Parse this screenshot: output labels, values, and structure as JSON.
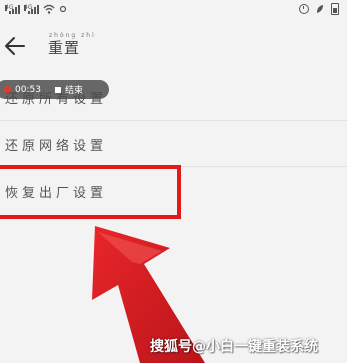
{
  "status_bar": {
    "network_label": "4G",
    "signal_icon": "signal-bars-icon",
    "wifi_icon": "wifi-icon",
    "alarm_icon": "alarm-clock-icon",
    "battery_icon": "battery-icon"
  },
  "header": {
    "back_icon": "arrow-left-icon",
    "title_pinyin": "zhòng zhì",
    "title": "重置"
  },
  "items": [
    {
      "label": "还原所有设置"
    },
    {
      "label": "还原网络设置"
    },
    {
      "label": "恢复出厂设置"
    }
  ],
  "recording": {
    "time": "00:53",
    "stop_label": "结束"
  },
  "watermark": {
    "text": "搜狐号@小白一键重装系统"
  },
  "colors": {
    "highlight": "#e21a1a",
    "arrow": "#d81f22",
    "record_dot": "#e23b2e"
  }
}
